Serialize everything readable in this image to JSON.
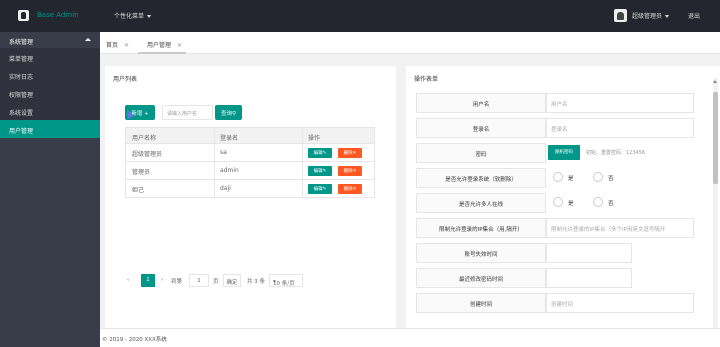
{
  "header": {
    "app_title": "Base Admin",
    "menu_label": "个性化菜单",
    "user_name": "超级管理员",
    "logout_label": "退出"
  },
  "sidebar": {
    "group_label": "系统管理",
    "items": [
      {
        "label": "菜单管理",
        "active": false
      },
      {
        "label": "实时日志",
        "active": false
      },
      {
        "label": "权限管理",
        "active": false
      },
      {
        "label": "系统设置",
        "active": false
      },
      {
        "label": "用户管理",
        "active": true
      }
    ]
  },
  "tabs": [
    {
      "label": "首页",
      "close": "✕"
    },
    {
      "label": "用户管理",
      "close": "✕"
    }
  ],
  "user_list": {
    "title": "用户列表",
    "add_button": "新增",
    "search_placeholder": "请输入用户名",
    "search_button": "查询",
    "columns": [
      "用户名称",
      "登录名",
      "操作"
    ],
    "rows": [
      {
        "name": "超级管理员",
        "login": "sa"
      },
      {
        "name": "管理员",
        "login": "admin"
      },
      {
        "name": "妲己",
        "login": "daji"
      }
    ],
    "edit_label": "编辑",
    "delete_label": "删除",
    "pager": {
      "current_page": "1",
      "goto_label": "到第",
      "goto_value": "1",
      "page_unit": "页",
      "confirm_label": "确定",
      "total_label": "共 3 条",
      "page_size": "10 条/页"
    }
  },
  "form": {
    "title": "操作表单",
    "fields": [
      {
        "label": "用户名",
        "placeholder": "用户名"
      },
      {
        "label": "登录名",
        "placeholder": "登录名"
      },
      {
        "label": "密码",
        "button": "随机密码",
        "hint": "初始、重置密码：123456"
      },
      {
        "label": "是否允许登录系统（软删除）",
        "yes": "是",
        "no": "否"
      },
      {
        "label": "是否允许多人在线",
        "yes": "是",
        "no": "否"
      },
      {
        "label": "限制允许登录的IP集合（用,隔开）",
        "placeholder": "限制允许登录的IP集合（多个IP用英文逗号隔开"
      },
      {
        "label": "账号失效时间",
        "placeholder": ""
      },
      {
        "label": "最近修改密码时间",
        "placeholder": ""
      },
      {
        "label": "创建时间",
        "placeholder": "创建时间"
      }
    ]
  },
  "footer": {
    "copyright": "© 2019 - 2020 XXX系统"
  },
  "colors": {
    "accent": "#009688",
    "danger": "#ff5722",
    "header_bg": "#23262e",
    "sidebar_bg": "#393d49"
  }
}
